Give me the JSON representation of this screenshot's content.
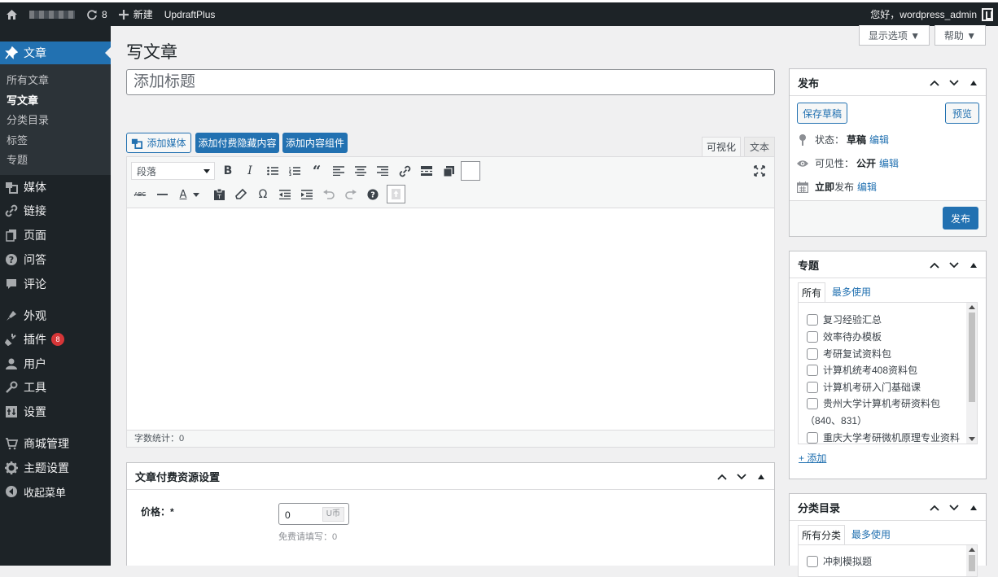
{
  "admin_bar": {
    "updates_count": "8",
    "new_label": "新建",
    "plugin_link": "UpdraftPlus",
    "greeting": "您好，wordpress_admin"
  },
  "sidebar": {
    "current": "文章",
    "submenu": [
      "所有文章",
      "写文章",
      "分类目录",
      "标签",
      "专题"
    ],
    "items": [
      {
        "label": "媒体",
        "icon": "media-icon"
      },
      {
        "label": "链接",
        "icon": "links-icon"
      },
      {
        "label": "页面",
        "icon": "page-icon"
      },
      {
        "label": "问答",
        "icon": "question-icon"
      },
      {
        "label": "评论",
        "icon": "comments-icon"
      },
      {
        "label": "外观",
        "icon": "appearance-icon"
      },
      {
        "label": "插件",
        "icon": "plugins-icon",
        "badge": "8"
      },
      {
        "label": "用户",
        "icon": "users-icon"
      },
      {
        "label": "工具",
        "icon": "tools-icon"
      },
      {
        "label": "设置",
        "icon": "settings-icon"
      },
      {
        "label": "商城管理",
        "icon": "cart-icon"
      },
      {
        "label": "主题设置",
        "icon": "gear-icon"
      },
      {
        "label": "收起菜单",
        "icon": "collapse-icon"
      }
    ]
  },
  "screen_options": {
    "label": "显示选项 ▼",
    "help": "帮助 ▼"
  },
  "page": {
    "title": "写文章",
    "title_placeholder": "添加标题"
  },
  "editor": {
    "add_media": "添加媒体",
    "add_paid_content": "添加付费隐藏内容",
    "add_component": "添加内容组件",
    "tab_visual": "可视化",
    "tab_text": "文本",
    "format_select": "段落",
    "word_count": "字数统计：0"
  },
  "paid_box": {
    "title": "文章付费资源设置",
    "price_label": "价格：*",
    "price_value": "0",
    "price_unit": "U币",
    "price_hint": "免费请填写：0"
  },
  "publish_box": {
    "title": "发布",
    "save_draft": "保存草稿",
    "preview": "预览",
    "status_label": "状态：",
    "status_value": "草稿",
    "visibility_label": "可见性：",
    "visibility_value": "公开",
    "schedule_value": "立即",
    "schedule_suffix": "发布",
    "edit": "编辑",
    "publish": "发布"
  },
  "topics_box": {
    "title": "专题",
    "tab_all": "所有",
    "tab_popular": "最多使用",
    "items": [
      "复习经验汇总",
      "效率待办模板",
      "考研复试资料包",
      "计算机统考408资料包",
      "计算机考研入门基础课",
      "贵州大学计算机考研资料包",
      "（840、831）",
      "重庆大学考研微机原理专业资料"
    ],
    "add_new": "+ 添加"
  },
  "category_box": {
    "title": "分类目录",
    "tab_all": "所有分类",
    "tab_popular": "最多使用",
    "first_item": "冲刺模拟题"
  }
}
